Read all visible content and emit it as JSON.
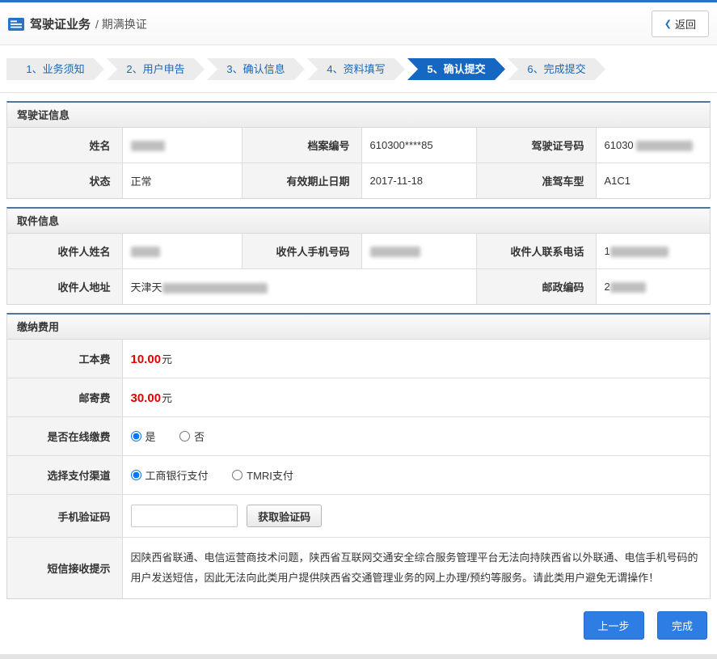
{
  "header": {
    "title": "驾驶证业务",
    "subtitle": "/ 期满换证",
    "back_label": "返回",
    "back_chevron": "❮"
  },
  "steps": {
    "items": [
      "1、业务须知",
      "2、用户申告",
      "3、确认信息",
      "4、资料填写",
      "5、确认提交",
      "6、完成提交"
    ],
    "active_index": 4
  },
  "license_section": {
    "title": "驾驶证信息",
    "labels": {
      "name": "姓名",
      "file_no": "档案编号",
      "license_no": "驾驶证号码",
      "status": "状态",
      "valid_until": "有效期止日期",
      "vehicle_class": "准驾车型"
    },
    "values": {
      "name": "",
      "file_no": "610300****85",
      "license_no_prefix": "61030",
      "status": "正常",
      "valid_until": "2017-11-18",
      "vehicle_class": "A1C1"
    }
  },
  "pickup_section": {
    "title": "取件信息",
    "labels": {
      "recipient_name": "收件人姓名",
      "mobile": "收件人手机号码",
      "phone": "收件人联系电话",
      "address": "收件人地址",
      "postcode": "邮政编码"
    },
    "values": {
      "recipient_name": "",
      "mobile": "",
      "phone_prefix": "1",
      "address_prefix": "天津天",
      "postcode_prefix": "2"
    }
  },
  "fees_section": {
    "title": "缴纳费用",
    "production_fee": {
      "label": "工本费",
      "amount": "10.00",
      "unit": "元"
    },
    "mailing_fee": {
      "label": "邮寄费",
      "amount": "30.00",
      "unit": "元"
    },
    "online_payment": {
      "label": "是否在线缴费",
      "options": [
        {
          "label": "是",
          "checked": true
        },
        {
          "label": "否",
          "checked": false
        }
      ]
    },
    "payment_channel": {
      "label": "选择支付渠道",
      "options": [
        {
          "label": "工商银行支付",
          "checked": true
        },
        {
          "label": "TMRI支付",
          "checked": false
        }
      ]
    },
    "sms_code": {
      "label": "手机验证码",
      "input_value": "",
      "button_label": "获取验证码"
    },
    "sms_notice": {
      "label": "短信接收提示",
      "text": "因陕西省联通、电信运营商技术问题，陕西省互联网交通安全综合服务管理平台无法向持陕西省以外联通、电信手机号码的用户发送短信，因此无法向此类用户提供陕西省交通管理业务的网上办理/预约等服务。请此类用户避免无谓操作！"
    }
  },
  "footer": {
    "prev_label": "上一步",
    "finish_label": "完成"
  },
  "colors": {
    "accent_blue": "#2a72c8",
    "step_text_blue": "#1a66b8",
    "active_step_bg": "#1567c2",
    "price_red": "#e60000",
    "button_blue": "#2e7de4"
  }
}
